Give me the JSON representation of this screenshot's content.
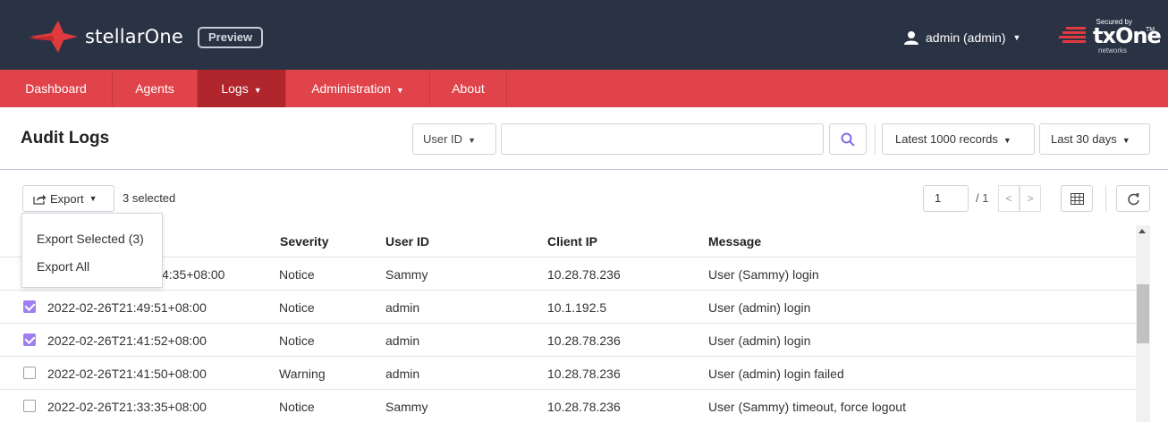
{
  "header": {
    "brand": "stellarOne",
    "preview_badge": "Preview",
    "user": "admin (admin)",
    "partner": {
      "secured_by": "Secured by",
      "name_tx": "tx",
      "name_one": "One",
      "tm": "TM",
      "networks": "networks"
    }
  },
  "nav": {
    "items": [
      {
        "label": "Dashboard",
        "caret": ""
      },
      {
        "label": "Agents",
        "caret": ""
      },
      {
        "label": "Logs",
        "caret": "▼"
      },
      {
        "label": "Administration",
        "caret": "▼"
      },
      {
        "label": "About",
        "caret": ""
      }
    ],
    "active_item": "Logs"
  },
  "page": {
    "title": "Audit Logs",
    "field_select": "User ID",
    "search_value": "",
    "records": "Latest 1000 records",
    "period": "Last 30 days"
  },
  "toolbar": {
    "export_label": "Export",
    "selected_text": "3 selected",
    "page_current": "1",
    "page_total": "/ 1",
    "prev": "<",
    "next": ">"
  },
  "export_menu": {
    "items": [
      "Export Selected (3)",
      "Export All"
    ]
  },
  "table": {
    "columns": [
      "Severity",
      "User ID",
      "Client IP",
      "Message"
    ],
    "rows": [
      {
        "checked": false,
        "date": "4:35+08:00",
        "severity": "Notice",
        "user": "Sammy",
        "ip": "10.28.78.236",
        "message": "User (Sammy) login"
      },
      {
        "checked": true,
        "date": "2022-02-26T21:49:51+08:00",
        "severity": "Notice",
        "user": "admin",
        "ip": "10.1.192.5",
        "message": "User (admin) login"
      },
      {
        "checked": true,
        "date": "2022-02-26T21:41:52+08:00",
        "severity": "Notice",
        "user": "admin",
        "ip": "10.28.78.236",
        "message": "User (admin) login"
      },
      {
        "checked": false,
        "date": "2022-02-26T21:41:50+08:00",
        "severity": "Warning",
        "user": "admin",
        "ip": "10.28.78.236",
        "message": "User (admin) login failed"
      },
      {
        "checked": false,
        "date": "2022-02-26T21:33:35+08:00",
        "severity": "Notice",
        "user": "Sammy",
        "ip": "10.28.78.236",
        "message": "User (Sammy) timeout, force logout"
      }
    ]
  },
  "colors": {
    "header_bg": "#2a3344",
    "nav_bg": "#e04349",
    "nav_active": "#b0262c",
    "checkbox_checked": "#9f7ff0",
    "search_icon": "#7b5ce6"
  }
}
